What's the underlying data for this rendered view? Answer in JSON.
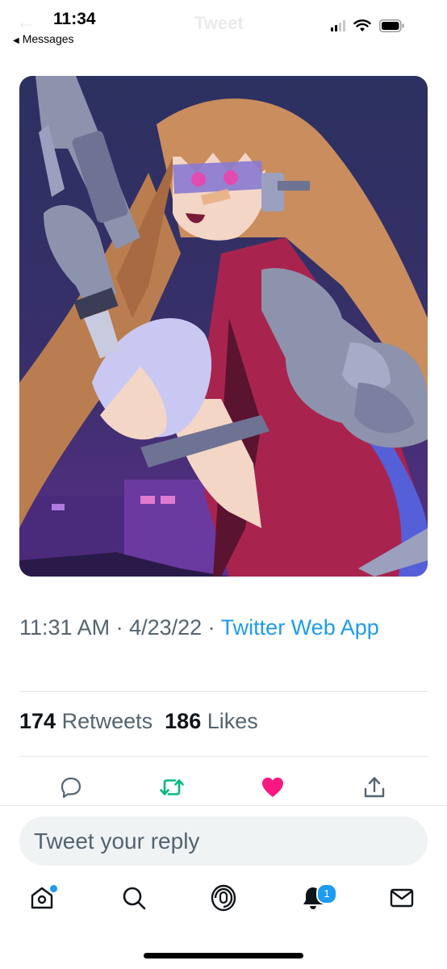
{
  "status_bar": {
    "time": "11:34",
    "back_app_label": "Messages",
    "faded_title": "Tweet",
    "faded_back_glyph": "←"
  },
  "tweet": {
    "timestamp": "11:31 AM · 4/23/22 ·",
    "source": "Twitter Web App",
    "retweets_count": "174",
    "retweets_label": "Retweets",
    "likes_count": "186",
    "likes_label": "Likes",
    "liked": true
  },
  "actions": [
    {
      "name": "reply-icon",
      "color": "#536471"
    },
    {
      "name": "retweet-icon",
      "color": "#00ba7c"
    },
    {
      "name": "like-icon",
      "color": "#f91880"
    },
    {
      "name": "share-icon",
      "color": "#536471"
    }
  ],
  "reply": {
    "placeholder": "Tweet your reply"
  },
  "tabbar": {
    "items": [
      "home-icon",
      "search-icon",
      "spaces-icon",
      "notifications-icon",
      "messages-icon"
    ],
    "notifications_badge": "1"
  },
  "colors": {
    "accent": "#1d9bf0",
    "text_secondary": "#536471",
    "retweet_green": "#00ba7c",
    "like_pink": "#f91880"
  }
}
